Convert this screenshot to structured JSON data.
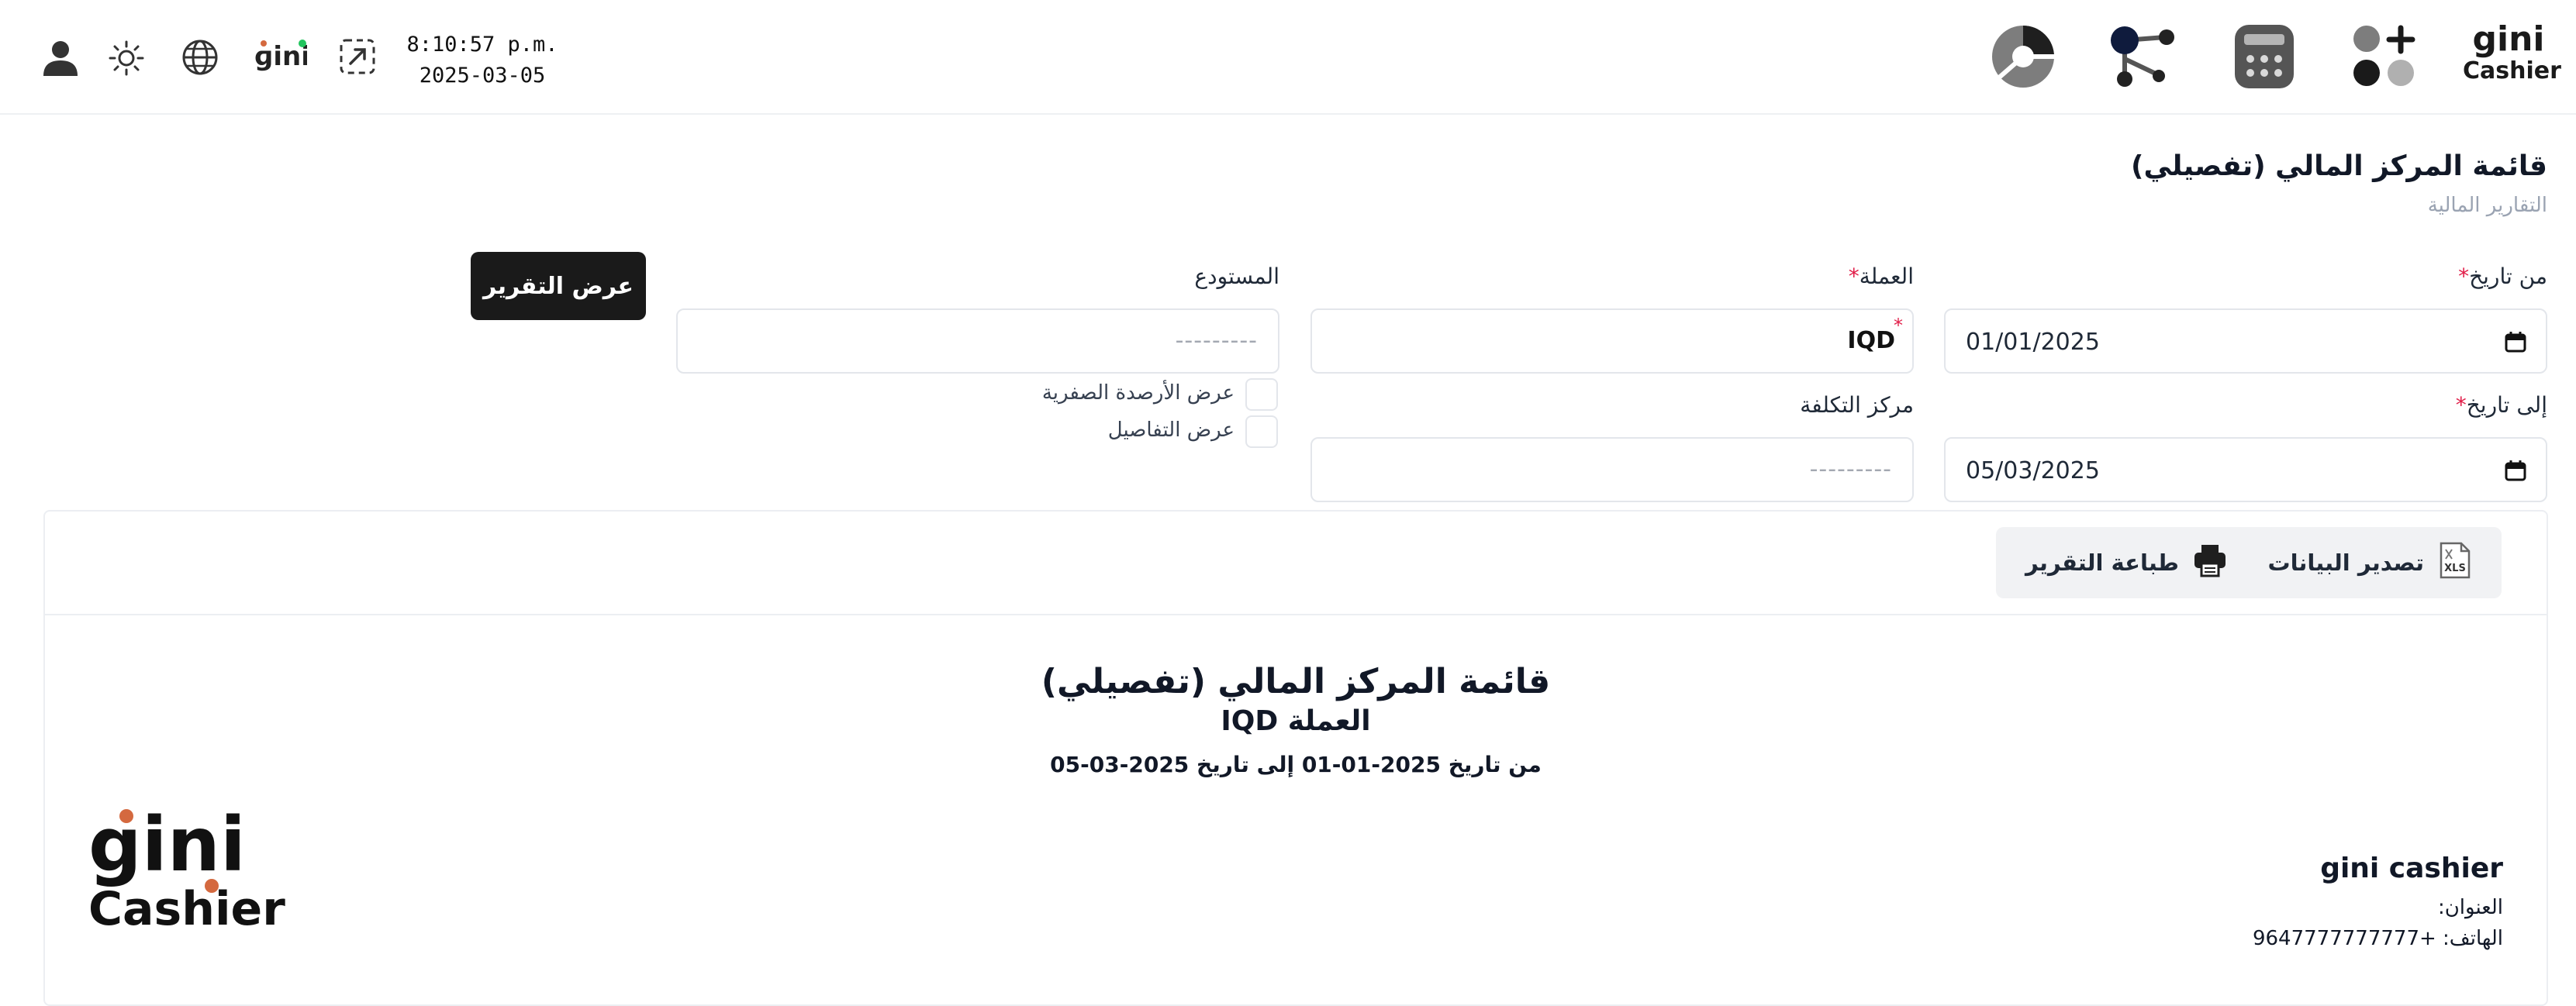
{
  "header": {
    "brand_name": "gini",
    "brand_sub": "Cashier",
    "clock_time": "8:10:57 p.m.",
    "clock_date": "2025-03-05",
    "language_brand": "gini"
  },
  "page": {
    "title": "قائمة المركز المالي (تفصيلي)",
    "breadcrumb": "التقارير المالية"
  },
  "filters": {
    "from_date_label": "من تاريخ",
    "from_date_value": "01/01/2025",
    "to_date_label": "إلى تاريخ",
    "to_date_value": "05/03/2025",
    "currency_label": "العملة",
    "currency_value": "IQD",
    "cost_center_label": "مركز التكلفة",
    "cost_center_placeholder": "---------",
    "warehouse_label": "المستودع",
    "warehouse_placeholder": "---------",
    "zero_balances_label": "عرض الأرصدة الصفرية",
    "details_label": "عرض التفاصيل",
    "show_report_button": "عرض التقرير",
    "required_mark": "*"
  },
  "report_actions": {
    "export_label": "تصدير البيانات",
    "export_icon_text": "XLS",
    "print_label": "طباعة التقرير"
  },
  "report": {
    "title": "قائمة المركز المالي (تفصيلي)",
    "currency_line": "العملة IQD",
    "date_range": "من تاريخ 2025-01-01 إلى تاريخ 2025-03-05",
    "company_name": "gini cashier",
    "address_line": "العنوان:",
    "phone_line": "الهاتف: +9647777777777",
    "logo_word": "gini",
    "logo_sub": "Cashier"
  },
  "colors": {
    "accent_orange": "#d4693f",
    "dark": "#1a1a1a",
    "required": "#e11d48"
  }
}
